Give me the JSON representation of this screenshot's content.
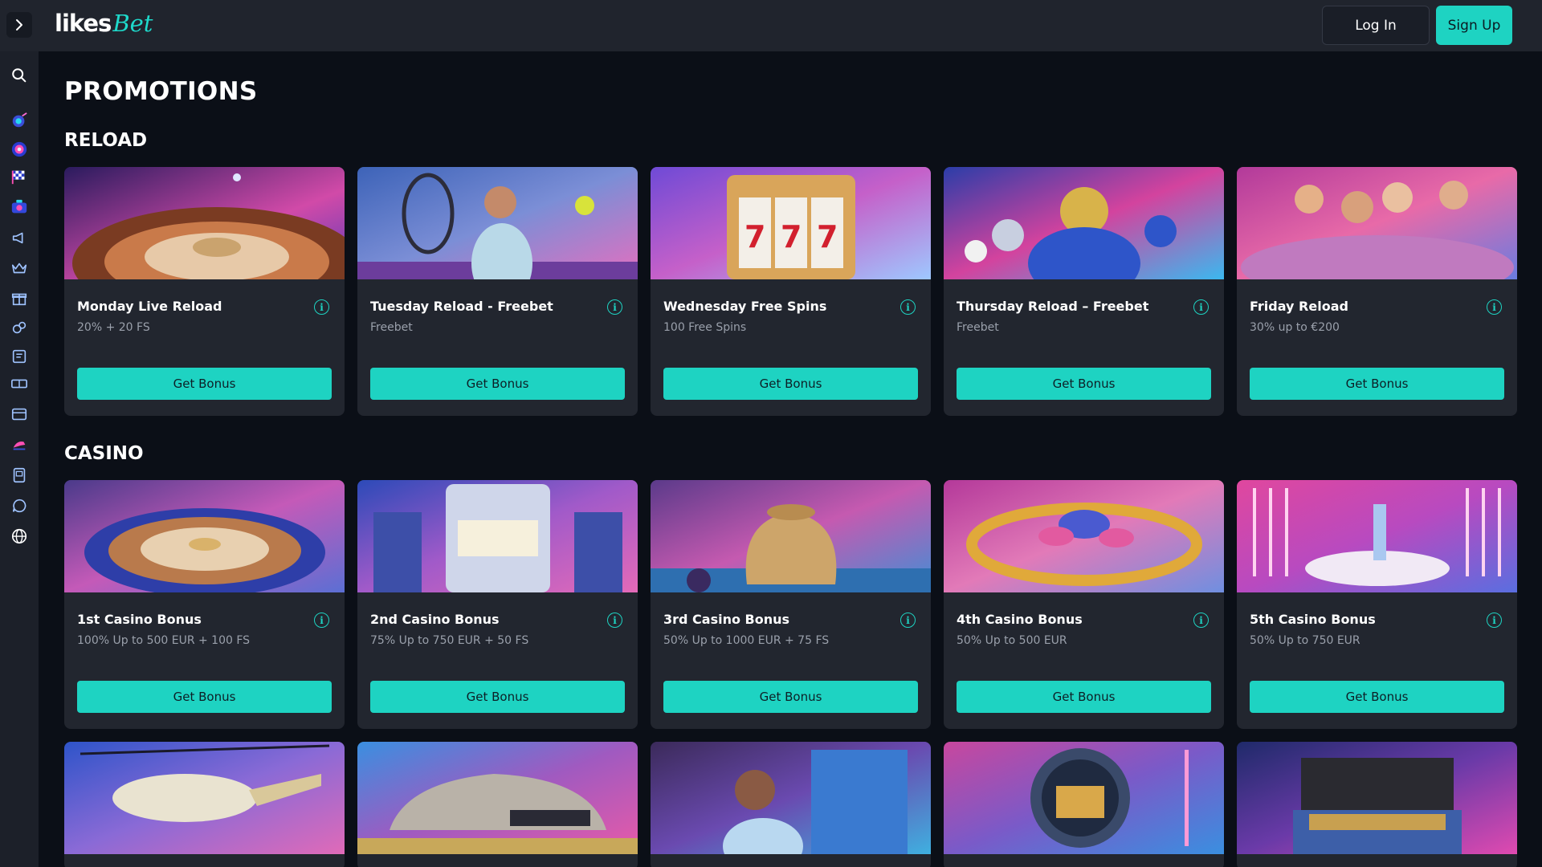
{
  "header": {
    "logo_primary": "likes",
    "logo_secondary": "Bet",
    "login_label": "Log In",
    "signup_label": "Sign Up"
  },
  "sidebar": {
    "icons": [
      "chevron-right-icon",
      "search-icon",
      "casino-icon",
      "roulette-icon",
      "racing-flag-icon",
      "live-casino-icon",
      "megaphone-icon",
      "crown-icon",
      "gift-box-icon",
      "sports-icon",
      "bets-icon",
      "tickets-icon",
      "mail-icon",
      "horse-racing-icon",
      "document-icon",
      "chat-icon",
      "globe-icon"
    ]
  },
  "page": {
    "title": "PROMOTIONS"
  },
  "sections": {
    "reload": {
      "title": "RELOAD",
      "cards": [
        {
          "title": "Monday Live Reload",
          "subtitle": "20% + 20 FS",
          "button": "Get Bonus",
          "image": "roulette-wheel"
        },
        {
          "title": "Tuesday Reload - Freebet",
          "subtitle": "Freebet",
          "button": "Get Bonus",
          "image": "tennis-player"
        },
        {
          "title": "Wednesday Free Spins",
          "subtitle": "100 Free Spins",
          "button": "Get Bonus",
          "image": "slot-machine-777"
        },
        {
          "title": "Thursday Reload – Freebet",
          "subtitle": "Freebet",
          "button": "Get Bonus",
          "image": "american-football-players"
        },
        {
          "title": "Friday Reload",
          "subtitle": "30% up to €200",
          "button": "Get Bonus",
          "image": "party-women"
        }
      ]
    },
    "casino": {
      "title": "CASINO",
      "cards": [
        {
          "title": "1st Casino Bonus",
          "subtitle": "100% Up to 500 EUR + 100 FS",
          "button": "Get Bonus",
          "image": "roulette-table"
        },
        {
          "title": "2nd Casino Bonus",
          "subtitle": "75% Up to 750 EUR + 50 FS",
          "button": "Get Bonus",
          "image": "slot-machines"
        },
        {
          "title": "3rd Casino Bonus",
          "subtitle": "50% Up to 1000 EUR + 75 FS",
          "button": "Get Bonus",
          "image": "gold-bag"
        },
        {
          "title": "4th Casino Bonus",
          "subtitle": "50% Up to 500 EUR",
          "button": "Get Bonus",
          "image": "gold-chain-chips"
        },
        {
          "title": "5th Casino Bonus",
          "subtitle": "50% Up to 750 EUR",
          "button": "Get Bonus",
          "image": "sports-car-neon"
        }
      ]
    },
    "more": {
      "cards": [
        {
          "image": "helicopter"
        },
        {
          "image": "gold-car"
        },
        {
          "image": "woman-slot"
        },
        {
          "image": "bank-vault"
        },
        {
          "image": "money-suitcase"
        }
      ]
    }
  },
  "colors": {
    "accent": "#1ed3c2",
    "background": "#0b0f17",
    "card": "#22262f",
    "topbar": "#20242d",
    "sidebar": "#1c2029",
    "muted_text": "#9aa0ab"
  }
}
